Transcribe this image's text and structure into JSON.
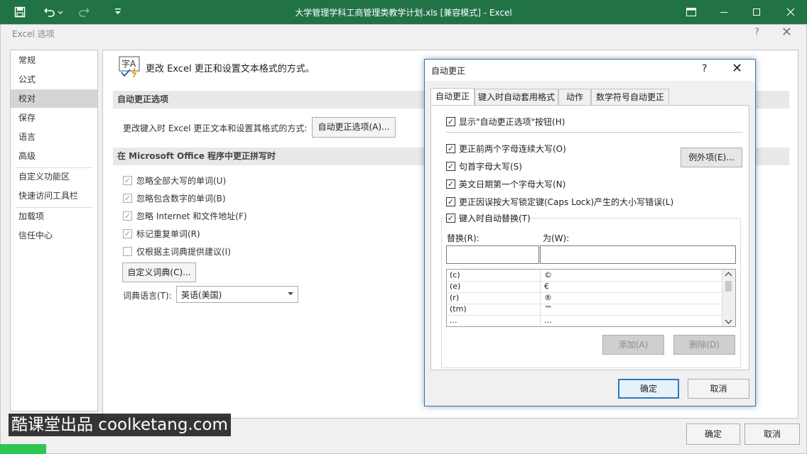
{
  "app": {
    "title": "大学管理学科工商管理类教学计划.xls  [兼容模式] - Excel",
    "qat": {
      "save_icon": "save-icon",
      "undo_icon": "undo-icon",
      "redo_icon": "redo-icon",
      "customize_icon": "chevron-down-icon"
    }
  },
  "options_dialog": {
    "title": "Excel 选项",
    "help": "?",
    "close": "✕",
    "nav": [
      "常规",
      "公式",
      "校对",
      "保存",
      "语言",
      "高级",
      "自定义功能区",
      "快速访问工具栏",
      "加载项",
      "信任中心"
    ],
    "selected_nav": "校对",
    "header_text": "更改 Excel 更正和设置文本格式的方式。",
    "section1": {
      "title": "自动更正选项",
      "desc": "更改键入时 Excel 更正文本和设置其格式的方式:",
      "button": "自动更正选项(A)..."
    },
    "section2": {
      "title": "在 Microsoft Office 程序中更正拼写时",
      "options": [
        {
          "label": "忽略全部大写的单词(U)",
          "checked": true
        },
        {
          "label": "忽略包含数字的单词(B)",
          "checked": true
        },
        {
          "label": "忽略 Internet 和文件地址(F)",
          "checked": true
        },
        {
          "label": "标记重复单词(R)",
          "checked": true
        },
        {
          "label": "仅根据主词典提供建议(I)",
          "checked": false
        }
      ],
      "custom_dict_button": "自定义词典(C)...",
      "dict_lang_label": "词典语言(T):",
      "dict_lang_value": "英语(美国)"
    },
    "ok": "确定",
    "cancel": "取消"
  },
  "autocorrect_dialog": {
    "title": "自动更正",
    "help": "?",
    "close": "✕",
    "tabs": [
      "自动更正",
      "键入时自动套用格式",
      "动作",
      "数学符号自动更正"
    ],
    "selected_tab": "自动更正",
    "show_buttons": {
      "label": "显示\"自动更正选项\"按钮(H)",
      "checked": true
    },
    "options": [
      {
        "label": "更正前两个字母连续大写(O)",
        "checked": true
      },
      {
        "label": "句首字母大写(S)",
        "checked": true
      },
      {
        "label": "英文日期第一个字母大写(N)",
        "checked": true
      },
      {
        "label": "更正因误按大写锁定键(Caps Lock)产生的大小写错误(L)",
        "checked": true
      },
      {
        "label": "键入时自动替换(T)",
        "checked": true
      }
    ],
    "exceptions_button": "例外项(E)...",
    "replace_label": "替换(R):",
    "with_label": "为(W):",
    "replace_value": "",
    "with_value": "",
    "table_rows": [
      [
        "(c)",
        "©"
      ],
      [
        "(e)",
        "€"
      ],
      [
        "(r)",
        "®"
      ],
      [
        "(tm)",
        "™"
      ],
      [
        "...",
        "..."
      ]
    ],
    "add_button": "添加(A)",
    "delete_button": "删除(D)",
    "ok": "确定",
    "cancel": "取消"
  },
  "watermark": "酷课堂出品 coolketang.com"
}
